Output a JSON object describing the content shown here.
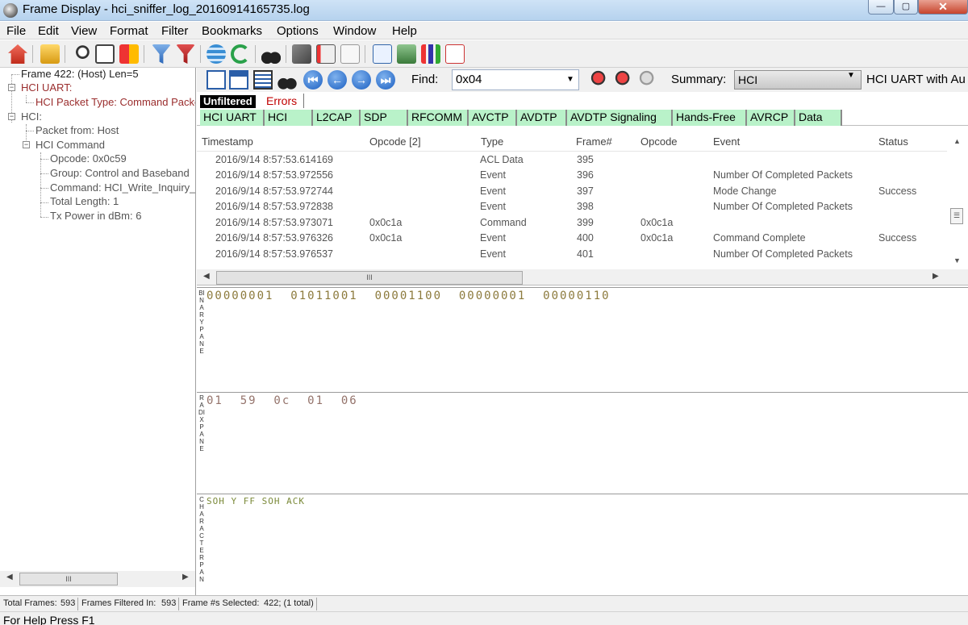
{
  "window": {
    "title": "Frame Display - hci_sniffer_log_20160914165735.log"
  },
  "menu": [
    "File",
    "Edit",
    "View",
    "Format",
    "Filter",
    "Bookmarks",
    "Options",
    "Window",
    "Help"
  ],
  "tree": {
    "items": [
      "Frame 422: (Host) Len=5",
      "HCI UART:",
      "HCI Packet Type: Command Packet",
      "HCI:",
      "Packet from: Host",
      "HCI Command",
      "Opcode: 0x0c59",
      "Group: Control and Baseband",
      "Command: HCI_Write_Inquiry_Transmit_Power_Level",
      "Total Length: 1",
      "Tx Power in dBm: 6"
    ],
    "scroll_thumb": "III"
  },
  "find": {
    "label": "Find:",
    "value": "0x04"
  },
  "summary": {
    "label": "Summary:",
    "value": "HCI",
    "description": "HCI UART with Au"
  },
  "filter_tabs": {
    "unfiltered": "Unfiltered",
    "errors": "Errors"
  },
  "protocol_tabs": [
    "HCI UART",
    "HCI",
    "L2CAP",
    "SDP",
    "RFCOMM",
    "AVCTP",
    "AVDTP",
    "AVDTP Signaling",
    "Hands-Free",
    "AVRCP",
    "Data"
  ],
  "grid": {
    "columns": [
      "Timestamp",
      "Opcode [2]",
      "Type",
      "Frame#",
      "Opcode",
      "Event",
      "Status"
    ],
    "rows": [
      {
        "timestamp": "2016/9/14 8:57:53.614169",
        "opcode2": "",
        "type": "ACL Data",
        "frame": "395",
        "opcode": "",
        "event": "",
        "status": ""
      },
      {
        "timestamp": "2016/9/14 8:57:53.972556",
        "opcode2": "",
        "type": "Event",
        "frame": "396",
        "opcode": "",
        "event": "Number Of Completed Packets",
        "status": ""
      },
      {
        "timestamp": "2016/9/14 8:57:53.972744",
        "opcode2": "",
        "type": "Event",
        "frame": "397",
        "opcode": "",
        "event": "Mode Change",
        "status": "Success"
      },
      {
        "timestamp": "2016/9/14 8:57:53.972838",
        "opcode2": "",
        "type": "Event",
        "frame": "398",
        "opcode": "",
        "event": "Number Of Completed Packets",
        "status": ""
      },
      {
        "timestamp": "2016/9/14 8:57:53.973071",
        "opcode2": "0x0c1a",
        "type": "Command",
        "frame": "399",
        "opcode": "0x0c1a",
        "event": "",
        "status": ""
      },
      {
        "timestamp": "2016/9/14 8:57:53.976326",
        "opcode2": "0x0c1a",
        "type": "Event",
        "frame": "400",
        "opcode": "0x0c1a",
        "event": "Command Complete",
        "status": "Success"
      },
      {
        "timestamp": "2016/9/14 8:57:53.976537",
        "opcode2": "",
        "type": "Event",
        "frame": "401",
        "opcode": "",
        "event": "Number Of Completed Packets",
        "status": ""
      }
    ],
    "scroll_thumb": "III"
  },
  "panes": {
    "binary": {
      "label": "BINARY PANE",
      "content": "00000001  01011001  00001100  00000001  00000110"
    },
    "radix": {
      "label": "RADIX PANE",
      "content": "01  59  0c  01  06"
    },
    "character": {
      "label": "CHARACTER PAN",
      "content": "SOH Y FF SOH ACK"
    }
  },
  "status": {
    "total_frames_label": "Total Frames:",
    "total_frames": "593",
    "filtered_label": "Frames Filtered In:",
    "filtered": "593",
    "selected_label": "Frame #s Selected:",
    "selected": "422; (1 total)"
  },
  "help": "For Help Press F1"
}
